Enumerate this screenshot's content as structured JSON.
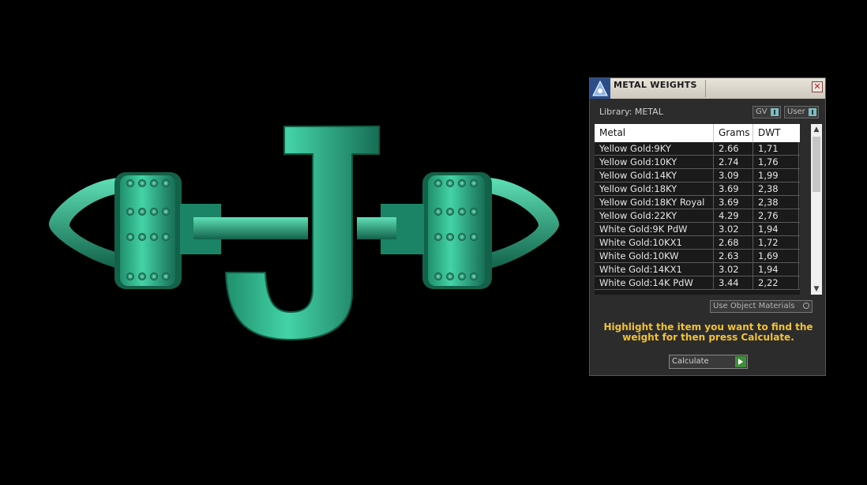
{
  "panel": {
    "title": "METAL WEIGHTS",
    "library_label": "Library: METAL",
    "toggles": [
      {
        "label": "GV"
      },
      {
        "label": "User"
      }
    ],
    "table": {
      "headers": [
        "Metal",
        "Grams",
        "DWT"
      ],
      "rows": [
        [
          "Yellow Gold:9KY",
          "2.66",
          "1,71"
        ],
        [
          "Yellow Gold:10KY",
          "2.74",
          "1,76"
        ],
        [
          "Yellow Gold:14KY",
          "3.09",
          "1,99"
        ],
        [
          "Yellow Gold:18KY",
          "3.69",
          "2,38"
        ],
        [
          "Yellow Gold:18KY Royal",
          "3.69",
          "2,38"
        ],
        [
          "Yellow Gold:22KY",
          "4.29",
          "2,76"
        ],
        [
          "White Gold:9K PdW",
          "3.02",
          "1,94"
        ],
        [
          "White Gold:10KX1",
          "2.68",
          "1,72"
        ],
        [
          "White Gold:10KW",
          "2.63",
          "1,69"
        ],
        [
          "White Gold:14KX1",
          "3.02",
          "1,94"
        ],
        [
          "White Gold:14K PdW",
          "3.44",
          "2,22"
        ]
      ]
    },
    "use_object_materials": "Use Object Materials",
    "hint": "Highlight the item you want to find the weight for then press Calculate.",
    "calculate_label": "Calculate"
  },
  "colors": {
    "model_green": "#2fb68c",
    "hint_yellow": "#f2c233",
    "background": "#000000"
  }
}
